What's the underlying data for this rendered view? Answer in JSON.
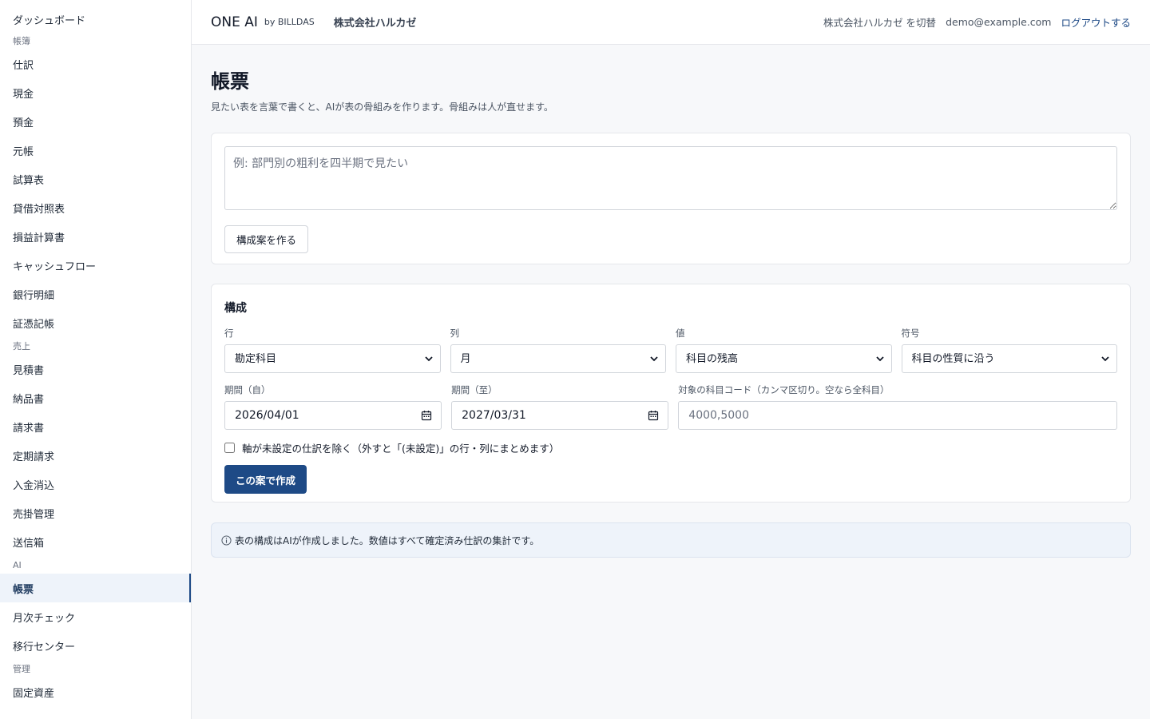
{
  "sidebar": {
    "items": [
      {
        "type": "item",
        "label": "ダッシュボード",
        "name": "sidebar-item-dashboard"
      },
      {
        "type": "section",
        "label": "帳簿",
        "name": "sidebar-section-books"
      },
      {
        "type": "item",
        "label": "仕訳",
        "name": "sidebar-item-journal"
      },
      {
        "type": "item",
        "label": "現金",
        "name": "sidebar-item-cash"
      },
      {
        "type": "item",
        "label": "預金",
        "name": "sidebar-item-deposits"
      },
      {
        "type": "item",
        "label": "元帳",
        "name": "sidebar-item-ledger"
      },
      {
        "type": "item",
        "label": "試算表",
        "name": "sidebar-item-trial-balance"
      },
      {
        "type": "item",
        "label": "貸借対照表",
        "name": "sidebar-item-balance-sheet"
      },
      {
        "type": "item",
        "label": "損益計算書",
        "name": "sidebar-item-income-statement"
      },
      {
        "type": "item",
        "label": "キャッシュフロー",
        "name": "sidebar-item-cash-flow"
      },
      {
        "type": "item",
        "label": "銀行明細",
        "name": "sidebar-item-bank-statements"
      },
      {
        "type": "item",
        "label": "証憑記帳",
        "name": "sidebar-item-voucher-entry"
      },
      {
        "type": "section",
        "label": "売上",
        "name": "sidebar-section-sales"
      },
      {
        "type": "item",
        "label": "見積書",
        "name": "sidebar-item-quotes"
      },
      {
        "type": "item",
        "label": "納品書",
        "name": "sidebar-item-delivery-notes"
      },
      {
        "type": "item",
        "label": "請求書",
        "name": "sidebar-item-invoices"
      },
      {
        "type": "item",
        "label": "定期請求",
        "name": "sidebar-item-recurring-billing"
      },
      {
        "type": "item",
        "label": "入金消込",
        "name": "sidebar-item-payment-matching"
      },
      {
        "type": "item",
        "label": "売掛管理",
        "name": "sidebar-item-receivables"
      },
      {
        "type": "item",
        "label": "送信箱",
        "name": "sidebar-item-outbox"
      },
      {
        "type": "section",
        "label": "AI",
        "name": "sidebar-section-ai"
      },
      {
        "type": "item",
        "label": "帳票",
        "name": "sidebar-item-reports",
        "active": true
      },
      {
        "type": "item",
        "label": "月次チェック",
        "name": "sidebar-item-monthly-check"
      },
      {
        "type": "item",
        "label": "移行センター",
        "name": "sidebar-item-migration-center"
      },
      {
        "type": "section",
        "label": "管理",
        "name": "sidebar-section-admin"
      },
      {
        "type": "item",
        "label": "固定資産",
        "name": "sidebar-item-fixed-assets"
      }
    ]
  },
  "header": {
    "brand": "ONE AI",
    "brand_sub": "by BILLDAS",
    "company": "株式会社ハルカゼ",
    "switch_company": "株式会社ハルカゼ を切替",
    "user_email": "demo@example.com",
    "logout": "ログアウトする"
  },
  "page": {
    "title": "帳票",
    "description": "見たい表を言葉で書くと、AIが表の骨組みを作ります。骨組みは人が直せます。"
  },
  "prompt": {
    "placeholder": "例: 部門別の粗利を四半期で見たい",
    "value": "",
    "button": "構成案を作る"
  },
  "config": {
    "title": "構成",
    "row_label": "行",
    "row_value": "勘定科目",
    "column_label": "列",
    "column_value": "月",
    "value_label": "値",
    "value_value": "科目の残高",
    "sign_label": "符号",
    "sign_value": "科目の性質に沿う",
    "period_from_label": "期間（自）",
    "period_from_value": "2026/04/01",
    "period_to_label": "期間（至）",
    "period_to_value": "2027/03/31",
    "account_codes_label": "対象の科目コード（カンマ区切り。空なら全科目）",
    "account_codes_placeholder": "4000,5000",
    "account_codes_value": "",
    "exclude_unset_label": "軸が未設定の仕訳を除く（外すと「(未設定)」の行・列にまとめます）",
    "exclude_unset_checked": false,
    "create_button": "この案で作成"
  },
  "info": {
    "icon": "info-icon",
    "text": "表の構成はAIが作成しました。数値はすべて確定済み仕訳の集計です。"
  },
  "colors": {
    "primary": "#1e4a86",
    "active_bg": "#eef3fa",
    "border": "#e5e7eb",
    "background": "#f7f8fa"
  }
}
